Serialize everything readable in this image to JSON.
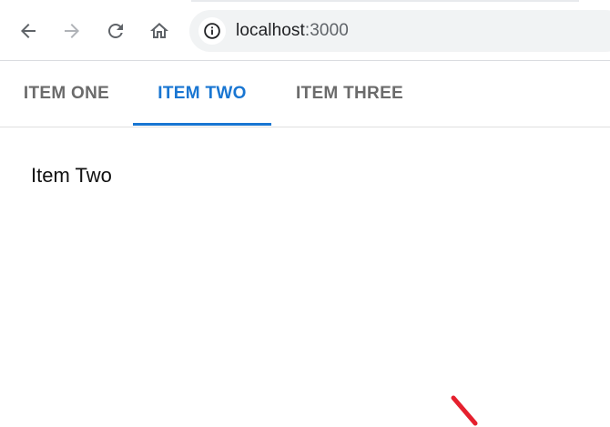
{
  "browser": {
    "url_host": "localhost",
    "url_port": ":3000",
    "icons": {
      "back": "arrow-back-icon",
      "forward": "arrow-forward-icon",
      "reload": "reload-icon",
      "home": "home-icon",
      "site_info": "info-icon"
    }
  },
  "tabs": [
    {
      "label": "ITEM ONE",
      "selected": false
    },
    {
      "label": "ITEM TWO",
      "selected": true
    },
    {
      "label": "ITEM THREE",
      "selected": false
    }
  ],
  "panel": {
    "content": "Item Two"
  },
  "colors": {
    "accent": "#1976d2",
    "tab_inactive": "#6b6b6b",
    "mark": "#e5202e"
  }
}
